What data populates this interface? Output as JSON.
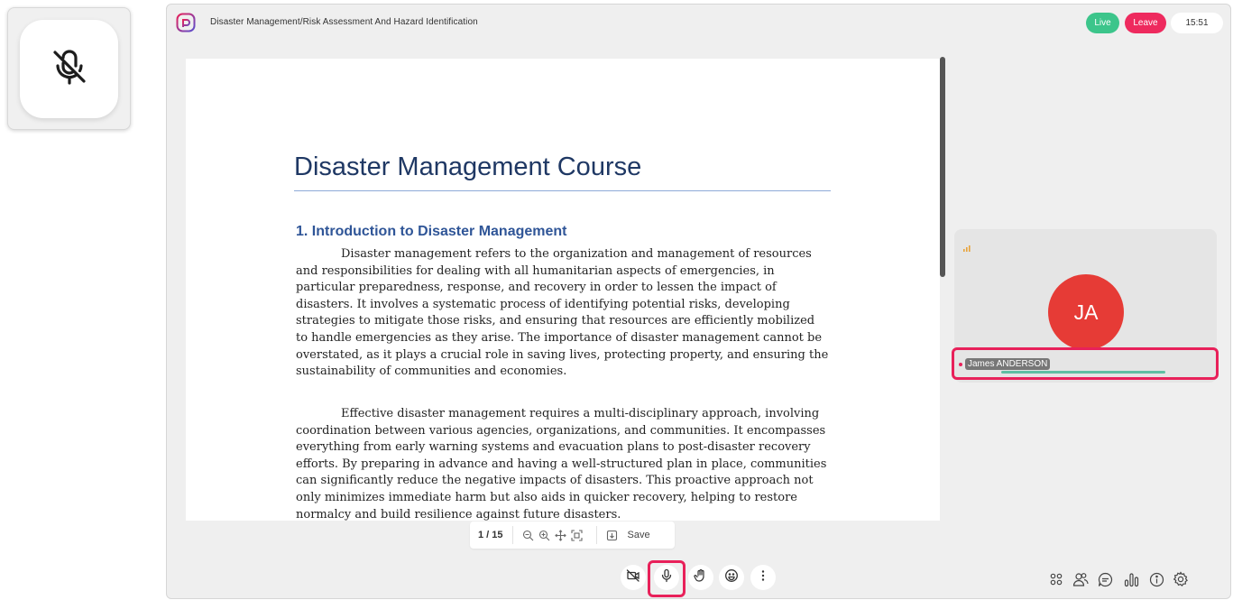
{
  "breadcrumb": "Disaster Management/Risk Assessment And Hazard Identification",
  "status": {
    "live": "Live",
    "leave": "Leave",
    "time": "15:51"
  },
  "document": {
    "title": "Disaster Management Course",
    "section_heading": "1. Introduction to Disaster Management",
    "paragraphs": [
      "Disaster management refers to the organization and management of resources and responsibilities for dealing with all humanitarian aspects of emergencies, in particular preparedness, response, and recovery in order to lessen the impact of disasters. It involves a systematic process of identifying potential risks, developing strategies to mitigate those risks, and ensuring that resources are efficiently mobilized to handle emergencies as they arise. The importance of disaster management cannot be overstated, as it plays a crucial role in saving lives, protecting property, and ensuring the sustainability of communities and economies.",
      "Effective disaster management requires a multi-disciplinary approach, involving coordination between various agencies, organizations, and communities. It encompasses everything from early warning systems and evacuation plans to post-disaster recovery efforts. By preparing in advance and having a well-structured plan in place, communities can significantly reduce the negative impacts of disasters. This proactive approach not only minimizes immediate harm but also aids in quicker recovery, helping to restore normalcy and build resilience against future disasters."
    ]
  },
  "doc_toolbar": {
    "page": "1 / 15",
    "save_label": "Save"
  },
  "participant": {
    "initials": "JA",
    "name": "James ANDERSON"
  },
  "colors": {
    "live": "#3cc58b",
    "leave": "#ee2a5e",
    "avatar": "#e63b36",
    "highlight": "#e8215a"
  },
  "icons": {
    "controls": [
      "camera-off-icon",
      "microphone-icon",
      "raise-hand-icon",
      "emoji-icon",
      "more-icon"
    ],
    "sidebar": [
      "layout-grid-icon",
      "participants-icon",
      "chat-icon",
      "poll-icon",
      "info-icon",
      "settings-icon"
    ]
  }
}
